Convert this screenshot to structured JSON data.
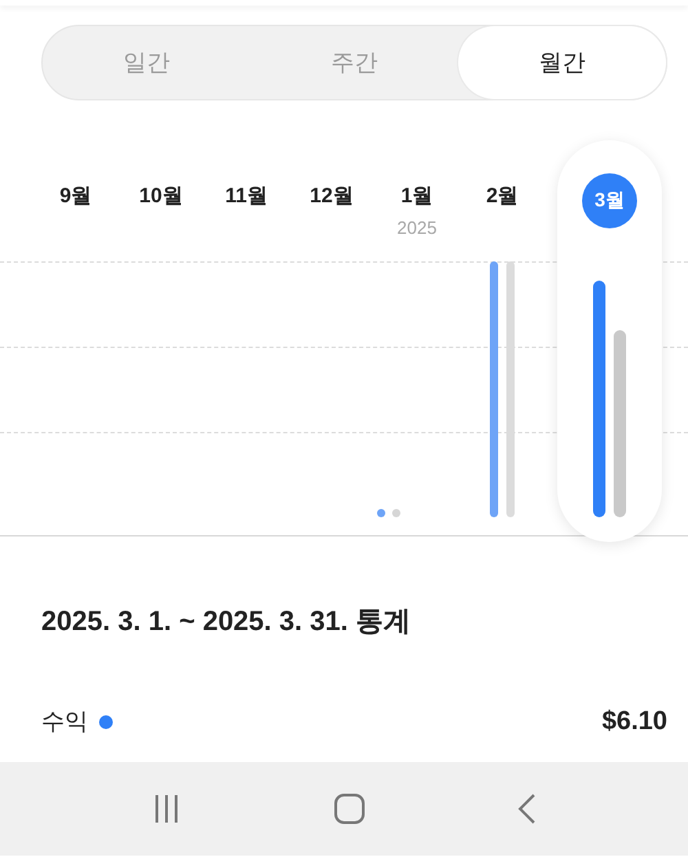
{
  "tabs": [
    {
      "label": "일간",
      "selected": false
    },
    {
      "label": "주간",
      "selected": false
    },
    {
      "label": "월간",
      "selected": true
    }
  ],
  "months": [
    {
      "label": "9월",
      "selected": false
    },
    {
      "label": "10월",
      "selected": false
    },
    {
      "label": "11월",
      "selected": false
    },
    {
      "label": "12월",
      "selected": false
    },
    {
      "label": "1월",
      "year": "2025",
      "selected": false
    },
    {
      "label": "2월",
      "selected": false
    },
    {
      "label": "3월",
      "selected": true
    }
  ],
  "pagination": [
    {
      "selected": true
    },
    {
      "selected": false
    }
  ],
  "stats": {
    "title": "2025. 3. 1. ~ 2025. 3. 31. 통계",
    "rows": [
      {
        "label": "수익",
        "color": "#2f80f7",
        "value": "$6.10"
      }
    ]
  }
}
